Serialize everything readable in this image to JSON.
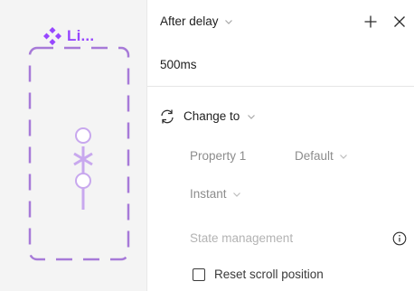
{
  "preview": {
    "component_name": "Li...",
    "accent_color": "#9747ff",
    "icon": "component-diamond-icon"
  },
  "panel": {
    "trigger_label": "After delay",
    "delay_value": "500ms",
    "add_icon": "plus-icon",
    "close_icon": "close-icon",
    "action_label": "Change to",
    "action_icon": "swap-arrows-icon",
    "property_label": "Property 1",
    "property_value": "Default",
    "animation_label": "Instant",
    "state_management_label": "State management",
    "info_icon": "info-icon",
    "reset_scroll_label": "Reset scroll position",
    "reset_scroll_checked": false
  }
}
